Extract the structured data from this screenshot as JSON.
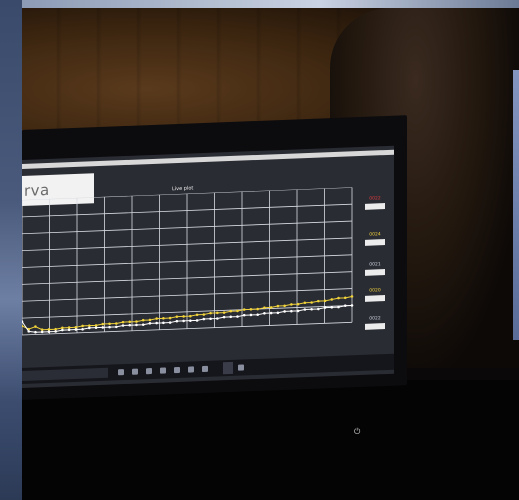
{
  "screen": {
    "header_text": "rva",
    "chart_title": "Live plot"
  },
  "chart_data": {
    "type": "line",
    "title": "Live plot",
    "xlabel": "",
    "ylabel": "",
    "grid": true,
    "series": [
      {
        "values": [
          0.8,
          0.5,
          0.7,
          0.4,
          0.4,
          0.4,
          0.5,
          0.5,
          0.5,
          0.6,
          0.6,
          0.6,
          0.7,
          0.7,
          0.7,
          0.8,
          0.8,
          0.8,
          0.9,
          0.9,
          1.0,
          1.0,
          1.0,
          1.1,
          1.1,
          1.1,
          1.2,
          1.2,
          1.3,
          1.3,
          1.3,
          1.4,
          1.4,
          1.5,
          1.5,
          1.5,
          1.6,
          1.6,
          1.7,
          1.7,
          1.8,
          1.8,
          1.9,
          1.9,
          2.0,
          2.0,
          2.1,
          2.2,
          2.2,
          2.3
        ],
        "color": "#f0d23a"
      },
      {
        "values": [
          1.2,
          0.3,
          0.2,
          0.2,
          0.2,
          0.2,
          0.3,
          0.3,
          0.3,
          0.3,
          0.4,
          0.4,
          0.4,
          0.4,
          0.4,
          0.5,
          0.5,
          0.5,
          0.5,
          0.6,
          0.6,
          0.6,
          0.6,
          0.7,
          0.7,
          0.7,
          0.7,
          0.8,
          0.8,
          0.8,
          0.9,
          0.9,
          0.9,
          1.0,
          1.0,
          1.0,
          1.1,
          1.1,
          1.1,
          1.2,
          1.2,
          1.2,
          1.3,
          1.3,
          1.3,
          1.4,
          1.4,
          1.4,
          1.5,
          1.5
        ],
        "color": "#ffffff"
      }
    ],
    "ylim": [
      0,
      12
    ],
    "xlim": [
      0,
      49
    ]
  },
  "readouts": [
    {
      "label": "0022",
      "color": "#e03a3a"
    },
    {
      "label": "0024",
      "color": "#f0d23a"
    },
    {
      "label": "0021",
      "color": "#cfd3dd"
    },
    {
      "label": "0020",
      "color": "#f0d23a"
    },
    {
      "label": "0022",
      "color": "#cfd3dd"
    }
  ],
  "power_icon": "power-icon"
}
